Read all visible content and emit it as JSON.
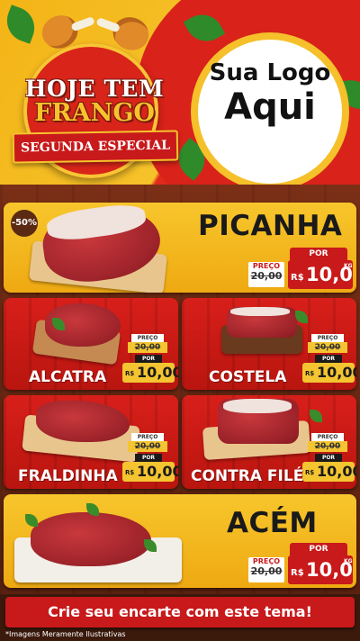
{
  "header": {
    "title_line1": "HOJE TEM",
    "title_line2": "FRANGO",
    "ribbon": "SEGUNDA ESPECIAL",
    "logo_line1": "Sua Logo",
    "logo_line2": "Aqui"
  },
  "labels": {
    "preco": "PREÇO",
    "por": "POR",
    "currency": "R$",
    "unit": "KG"
  },
  "products": {
    "picanha": {
      "name": "PICANHA",
      "badge": "-50%",
      "old_price": "20,00",
      "new_price": "10,00"
    },
    "alcatra": {
      "name": "ALCATRA",
      "old_price": "20,00",
      "new_price": "10,00"
    },
    "costela": {
      "name": "COSTELA",
      "old_price": "20,00",
      "new_price": "10,00"
    },
    "fraldinha": {
      "name": "FRALDINHA",
      "old_price": "20,00",
      "new_price": "10,00"
    },
    "contra_file": {
      "name": "CONTRA FILÉ",
      "old_price": "20,00",
      "new_price": "10,00"
    },
    "acem": {
      "name": "ACÉM",
      "old_price": "20,00",
      "new_price": "10,00"
    }
  },
  "footer": {
    "cta": "Crie seu encarte com este tema!",
    "disclaimer": "*Imagens Meramente Ilustrativas"
  },
  "colors": {
    "accent_yellow": "#f6c32c",
    "accent_red": "#c8191b",
    "wood_brown": "#5a2a12"
  }
}
